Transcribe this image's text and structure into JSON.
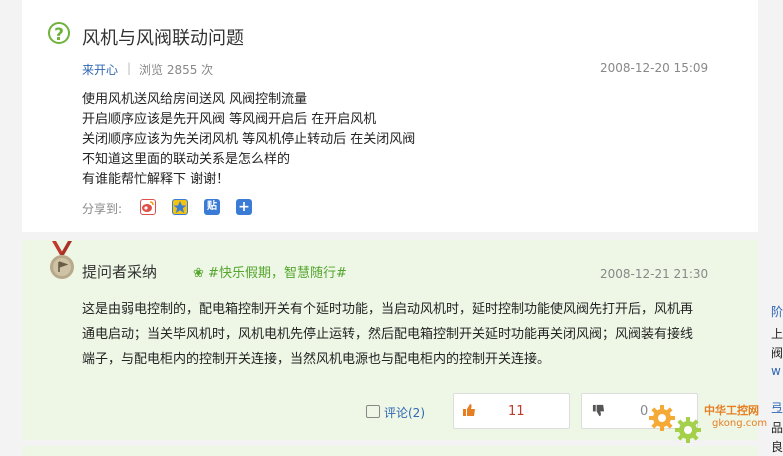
{
  "question": {
    "title": "风机与风阀联动问题",
    "author": "来开心",
    "views": "浏览 2855 次",
    "date": "2008-12-20 15:09",
    "body": [
      "使用风机送风给房间送风 风阀控制流量",
      "开启顺序应该是先开风阀 等风阀开启后 在开启风机",
      "关闭顺序应该为先关闭风机 等风机停止转动后 在关闭风阀",
      "不知道这里面的联动关系是怎么样的",
      "有谁能帮忙解释下 谢谢！"
    ],
    "share_label": "分享到:",
    "share_icons": [
      "weibo-icon",
      "qzone-icon",
      "tieba-icon",
      "more-share-icon"
    ]
  },
  "answer": {
    "title": "提问者采纳",
    "topic": "#快乐假期，智慧随行#",
    "date": "2008-12-21 21:30",
    "body": "这是由弱电控制的，配电箱控制开关有个延时功能，当启动风机时，延时控制功能使风阀先打开后，风机再通电启动；当关毕风机时，风机电机先停止运转，然后配电箱控制开关延时功能再关闭风阀；风阀装有接线端子，与配电柜内的控制开关连接，当然风机电源也与配电柜内的控制开关连接。",
    "comment_label": "评论(2)",
    "like_count": "11",
    "dislike_count": "0"
  },
  "sidebar": {
    "chars": [
      "阶",
      "上",
      "阀",
      "w",
      "弖",
      "品",
      "良"
    ]
  },
  "watermark": {
    "line1": "中华工控网",
    "line2": "gkong.com"
  },
  "colors": {
    "accent_green": "#6fb33b",
    "link_blue": "#2f66b5",
    "like_red": "#c0392b",
    "answer_bg": "#eef7e6"
  }
}
